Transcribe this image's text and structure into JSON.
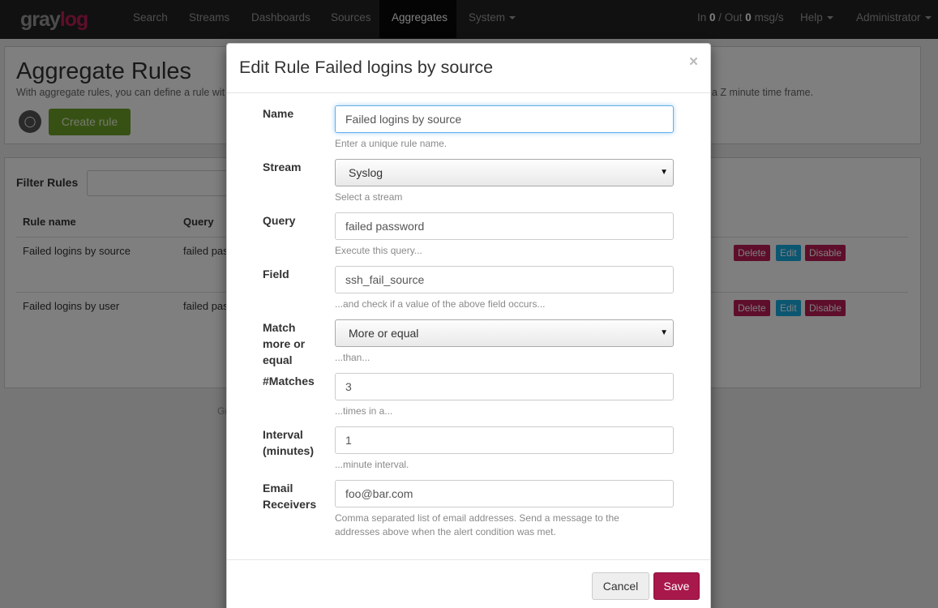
{
  "navbar": {
    "logo_gray": "gray",
    "logo_log": "log",
    "items": [
      "Search",
      "Streams",
      "Dashboards",
      "Sources",
      "Aggregates",
      "System"
    ],
    "active_item": "Aggregates",
    "throughput_prefix": "In ",
    "throughput_in": "0",
    "throughput_mid": " / Out ",
    "throughput_out": "0",
    "throughput_suffix": " msg/s",
    "help": "Help",
    "user": "Administrator"
  },
  "page": {
    "title": "Aggregate Rules",
    "description": "With aggregate rules, you can define a rule wit",
    "description_tail": "a Z minute time frame.",
    "bulb_icon": "lightbulb-icon",
    "create_button": "Create rule",
    "filter_label": "Filter Rules",
    "columns": [
      "Rule name",
      "Query"
    ],
    "rows": [
      {
        "name": "Failed logins by source",
        "query": "failed pas"
      },
      {
        "name": "Failed logins by user",
        "query": "failed pas"
      }
    ],
    "row_actions": [
      "Delete",
      "Edit",
      "Disable"
    ],
    "footer": "Gr"
  },
  "modal": {
    "title": "Edit Rule Failed logins by source",
    "close": "×",
    "fields": {
      "name": {
        "label": "Name",
        "value": "Failed logins by source",
        "help": "Enter a unique rule name."
      },
      "stream": {
        "label": "Stream",
        "value": "Syslog",
        "help": "Select a stream"
      },
      "query": {
        "label": "Query",
        "value": "failed password",
        "help": "Execute this query..."
      },
      "field": {
        "label": "Field",
        "value": "ssh_fail_source",
        "help": "...and check if a value of the above field occurs..."
      },
      "match": {
        "label": "Match more or equal",
        "value": "More or equal",
        "help": "...than..."
      },
      "matches": {
        "label": "#Matches",
        "value": "3",
        "help": "...times in a..."
      },
      "interval": {
        "label": "Interval (minutes)",
        "value": "1",
        "help": "...minute interval."
      },
      "email": {
        "label": "Email Receivers",
        "value": "foo@bar.com",
        "help": "Comma separated list of email addresses. Send a message to the addresses above when the alert condition was met."
      }
    },
    "cancel": "Cancel",
    "save": "Save"
  },
  "colors": {
    "navbar_bg": "#222222",
    "brand": "#bd1d55",
    "save_button": "#a8184a",
    "create_button": "#6fa329",
    "edit_button": "#16ace3",
    "focus_border": "#66afe9"
  }
}
